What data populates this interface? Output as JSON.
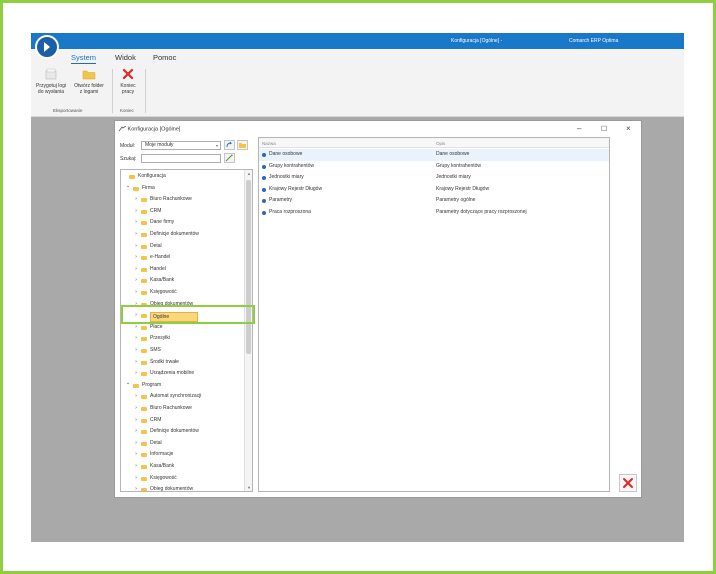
{
  "window": {
    "title": "Konfiguracja [Ogólne] -",
    "app_name": "Comarch ERP Optima"
  },
  "menu": {
    "system": "System",
    "widok": "Widok",
    "pomoc": "Pomoc"
  },
  "ribbon": {
    "btn_logs_l1": "Przygotuj logi",
    "btn_logs_l2": "do wysłania",
    "btn_folder_l1": "Otwórz folder",
    "btn_folder_l2": "z logami",
    "btn_exit_l1": "Koniec",
    "btn_exit_l2": "pracy",
    "group_export": "Eksportowanie",
    "group_end": "Koniec"
  },
  "dialog": {
    "title": "Konfiguracja [Ogólne]",
    "modul_label": "Moduł:",
    "modul_value": "Moje moduły",
    "szukaj_label": "Szukaj:",
    "szukaj_value": "",
    "tree": [
      {
        "label": "Konfiguracja",
        "level": 0,
        "arrow": ""
      },
      {
        "label": "Firma",
        "level": 1,
        "arrow": "v"
      },
      {
        "label": "Biuro Rachunkowe",
        "level": 2,
        "arrow": ">"
      },
      {
        "label": "CRM",
        "level": 2,
        "arrow": ">"
      },
      {
        "label": "Dane firmy",
        "level": 2,
        "arrow": ">"
      },
      {
        "label": "Definicje dokumentów",
        "level": 2,
        "arrow": ">"
      },
      {
        "label": "Detal",
        "level": 2,
        "arrow": ">"
      },
      {
        "label": "e-Handel",
        "level": 2,
        "arrow": ">"
      },
      {
        "label": "Handel",
        "level": 2,
        "arrow": ">"
      },
      {
        "label": "Kasa/Bank",
        "level": 2,
        "arrow": ">"
      },
      {
        "label": "Księgowość",
        "level": 2,
        "arrow": ">"
      },
      {
        "label": "Obieg dokumentów",
        "level": 2,
        "arrow": ">"
      },
      {
        "label": "Ogólne",
        "level": 2,
        "arrow": ">",
        "selected": true
      },
      {
        "label": "Płace",
        "level": 2,
        "arrow": ">"
      },
      {
        "label": "Przesyłki",
        "level": 2,
        "arrow": ">"
      },
      {
        "label": "SMS",
        "level": 2,
        "arrow": ">"
      },
      {
        "label": "Środki trwałe",
        "level": 2,
        "arrow": ">"
      },
      {
        "label": "Urządzenia mobilne",
        "level": 2,
        "arrow": ">"
      },
      {
        "label": "Program",
        "level": 1,
        "arrow": "v"
      },
      {
        "label": "Automat synchronizacji",
        "level": 2,
        "arrow": ">"
      },
      {
        "label": "Biuro Rachunkowe",
        "level": 2,
        "arrow": ">"
      },
      {
        "label": "CRM",
        "level": 2,
        "arrow": ">"
      },
      {
        "label": "Definicje dokumentów",
        "level": 2,
        "arrow": ">"
      },
      {
        "label": "Detal",
        "level": 2,
        "arrow": ">"
      },
      {
        "label": "Informacje",
        "level": 2,
        "arrow": ">"
      },
      {
        "label": "Kasa/Bank",
        "level": 2,
        "arrow": ">"
      },
      {
        "label": "Księgowość",
        "level": 2,
        "arrow": ">"
      },
      {
        "label": "Obieg dokumentów",
        "level": 2,
        "arrow": ">"
      }
    ],
    "grid": {
      "col_nazwa": "Nazwa",
      "col_opis": "Opis",
      "rows": [
        {
          "nazwa": "Dane osobowe",
          "opis": "Dane osobowe"
        },
        {
          "nazwa": "Grupy kontrahentów",
          "opis": "Grupy kontrahentów"
        },
        {
          "nazwa": "Jednostki miary",
          "opis": "Jednostki miary"
        },
        {
          "nazwa": "Krajowy Rejestr Długów",
          "opis": "Krajowy Rejestr Długów"
        },
        {
          "nazwa": "Parametry",
          "opis": "Parametry ogólne"
        },
        {
          "nazwa": "Praca rozproszona",
          "opis": "Parametry dotyczące pracy rozproszonej"
        }
      ]
    }
  },
  "colors": {
    "titlebar": "#1a78c8",
    "accent": "#1a6fc0",
    "highlight": "#8dcf3f",
    "selection": "#fbd779",
    "folder": "#f2c44a",
    "exit_red": "#e0262a"
  }
}
